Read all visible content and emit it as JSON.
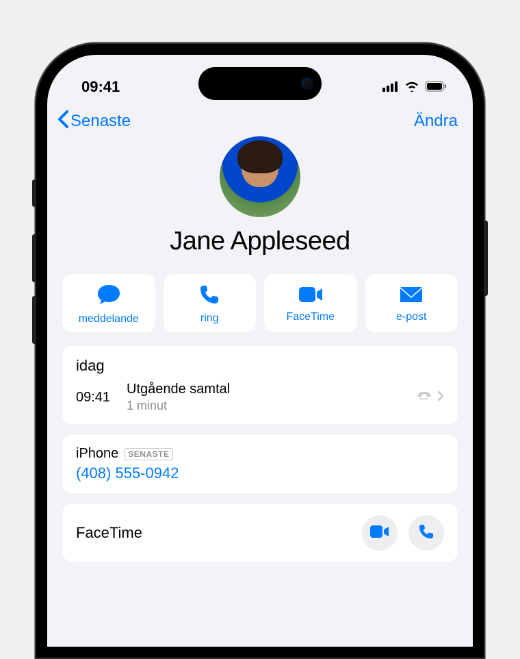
{
  "status": {
    "time": "09:41"
  },
  "nav": {
    "back_label": "Senaste",
    "edit_label": "Ändra"
  },
  "contact": {
    "name": "Jane Appleseed"
  },
  "actions": {
    "message": "meddelande",
    "call": "ring",
    "facetime": "FaceTime",
    "mail": "e-post"
  },
  "recent": {
    "header": "idag",
    "time": "09:41",
    "type": "Utgående samtal",
    "duration": "1 minut"
  },
  "phone": {
    "label": "iPhone",
    "badge": "SENASTE",
    "number": "(408) 555-0942"
  },
  "facetime": {
    "label": "FaceTime"
  }
}
